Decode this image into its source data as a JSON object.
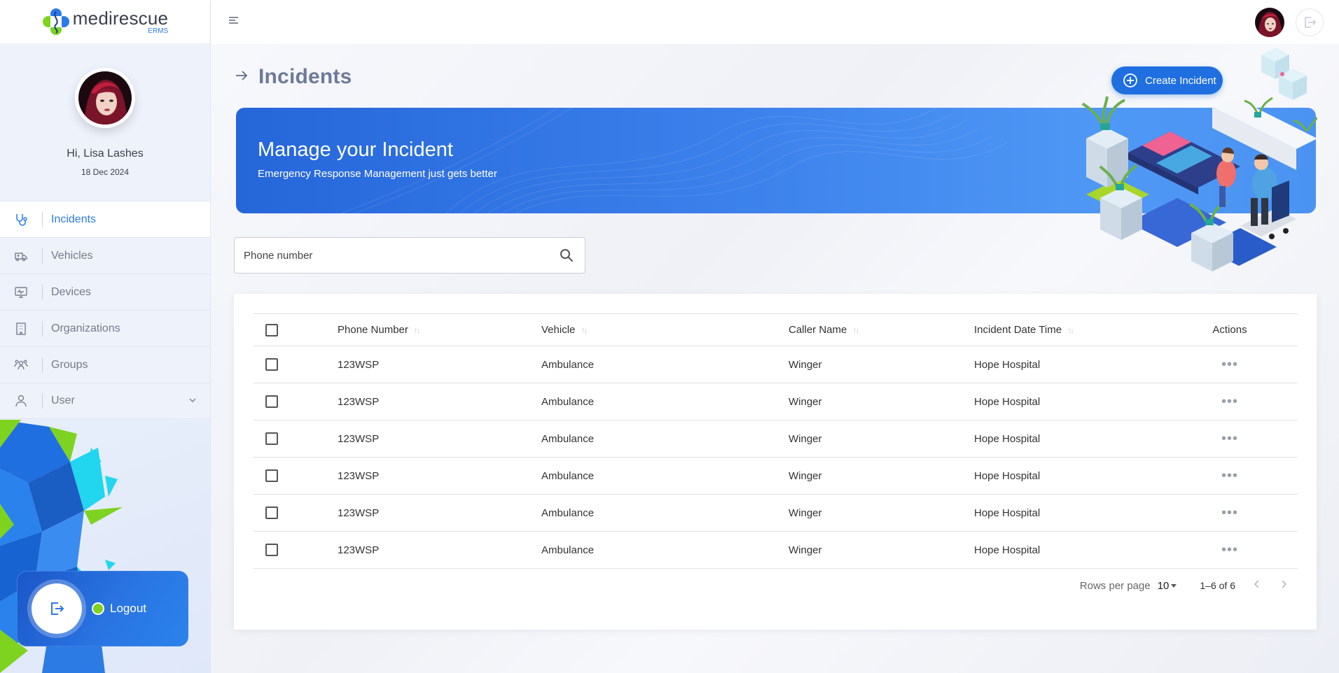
{
  "brand": {
    "name": "medirescue",
    "sub": "ERMS"
  },
  "profile": {
    "greeting": "Hi, Lisa Lashes",
    "date": "18 Dec 2024"
  },
  "nav": {
    "items": [
      {
        "label": "Incidents",
        "icon": "stethoscope-icon",
        "active": true
      },
      {
        "label": "Vehicles",
        "icon": "ambulance-icon"
      },
      {
        "label": "Devices",
        "icon": "monitor-icon"
      },
      {
        "label": "Organizations",
        "icon": "building-icon"
      },
      {
        "label": "Groups",
        "icon": "group-icon"
      },
      {
        "label": "User",
        "icon": "user-icon"
      }
    ]
  },
  "logout": {
    "label": "Logout"
  },
  "page": {
    "title": "Incidents",
    "create_label": "Create Incident"
  },
  "banner": {
    "title": "Manage your Incident",
    "subtitle": "Emergency Response Management just gets better"
  },
  "search": {
    "placeholder": "Phone number"
  },
  "table": {
    "headers": {
      "phone": "Phone Number",
      "vehicle": "Vehicle",
      "caller": "Caller Name",
      "date": "Incident Date Time",
      "actions": "Actions"
    },
    "rows": [
      {
        "phone": "123WSP",
        "vehicle": "Ambulance",
        "caller": "Winger",
        "date": "Hope Hospital"
      },
      {
        "phone": "123WSP",
        "vehicle": "Ambulance",
        "caller": "Winger",
        "date": "Hope Hospital"
      },
      {
        "phone": "123WSP",
        "vehicle": "Ambulance",
        "caller": "Winger",
        "date": "Hope Hospital"
      },
      {
        "phone": "123WSP",
        "vehicle": "Ambulance",
        "caller": "Winger",
        "date": "Hope Hospital"
      },
      {
        "phone": "123WSP",
        "vehicle": "Ambulance",
        "caller": "Winger",
        "date": "Hope Hospital"
      },
      {
        "phone": "123WSP",
        "vehicle": "Ambulance",
        "caller": "Winger",
        "date": "Hope Hospital"
      }
    ],
    "actions_glyph": "•••"
  },
  "pagination": {
    "rows_label": "Rows per page",
    "rows_value": "10",
    "range": "1–6 of 6"
  },
  "colors": {
    "accent": "#2c7be5",
    "primary_button": "#1f6fe0",
    "online": "#7ed321"
  }
}
